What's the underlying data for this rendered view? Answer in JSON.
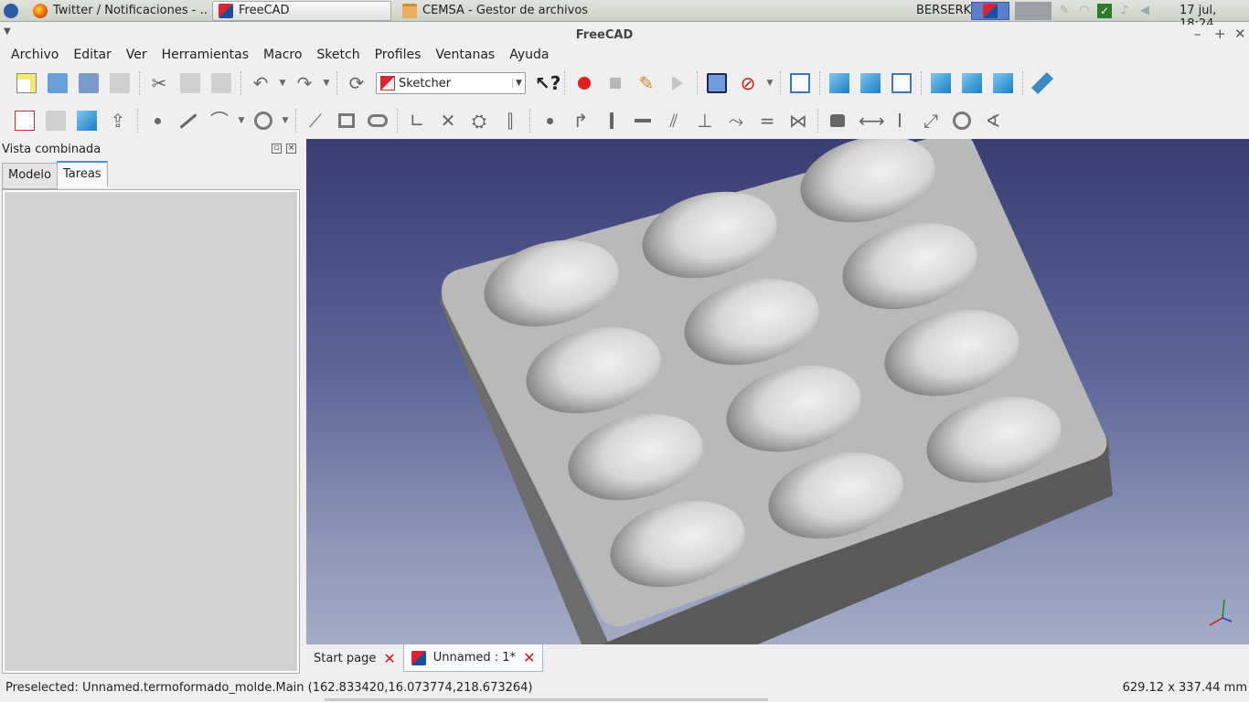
{
  "taskbar": {
    "tasks": [
      {
        "label": "Twitter / Notificaciones - ...",
        "icon": "firefox-icon"
      },
      {
        "label": "FreeCAD",
        "icon": "freecad-icon"
      },
      {
        "label": "CEMSA - Gestor de archivos",
        "icon": "folder-icon"
      }
    ],
    "user": "BERSERK",
    "clock": "17 jul, 18:24"
  },
  "window": {
    "title": "FreeCAD",
    "minimize": "–",
    "maximize": "+",
    "close": "✕"
  },
  "menu": {
    "items": [
      "Archivo",
      "Editar",
      "Ver",
      "Herramientas",
      "Macro",
      "Sketch",
      "Profiles",
      "Ventanas",
      "Ayuda"
    ]
  },
  "toolbar": {
    "workbench": "Sketcher"
  },
  "combo_view": {
    "title": "Vista combinada",
    "tabs": [
      "Modelo",
      "Tareas"
    ],
    "active_tab": "Tareas"
  },
  "doc_tabs": [
    {
      "label": "Start page",
      "close": "✕"
    },
    {
      "label": "Unnamed : 1*",
      "close": "✕"
    }
  ],
  "status": {
    "message": "Preselected: Unnamed.termoformado_molde.Main (162.833420,16.073774,218.673264)",
    "dimensions": "629.12 x 337.44 mm"
  },
  "colors": {
    "view_top": "#383d72",
    "view_bottom": "#a4abc6",
    "mold_face": "#b9b9b9",
    "mold_side": "#6c6c6c",
    "record": "#e02020",
    "close": "#d01818"
  }
}
